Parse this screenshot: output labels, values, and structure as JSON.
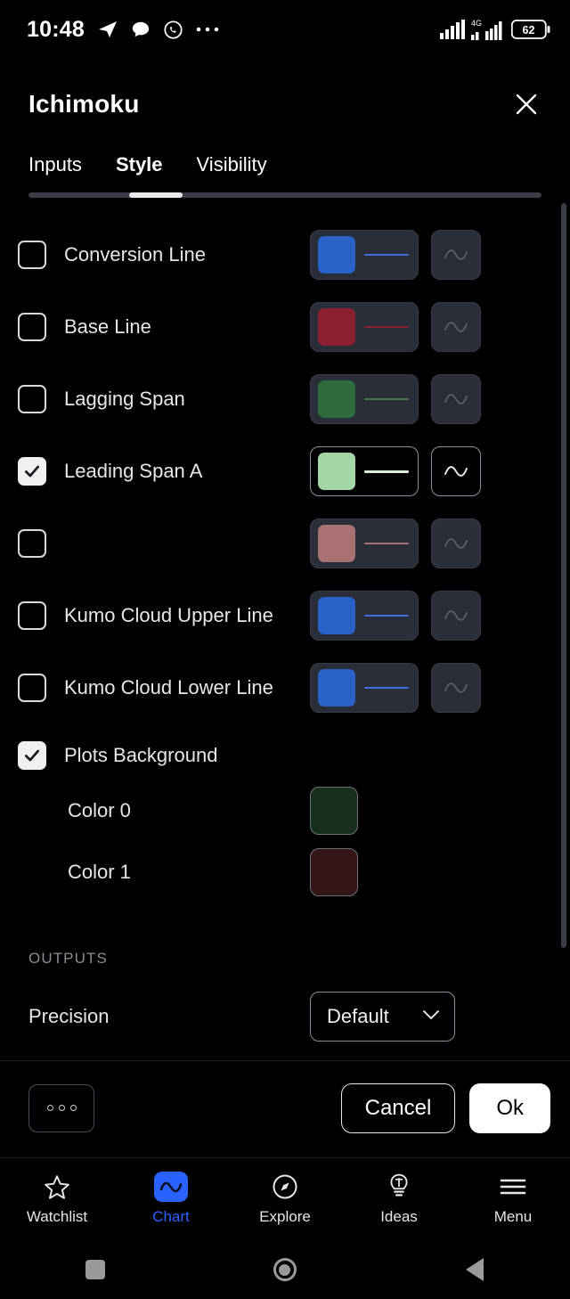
{
  "status_bar": {
    "time": "10:48",
    "network": "4G",
    "battery": "62",
    "icons": [
      "telegram-icon",
      "chat-bubble-icon",
      "whatsapp-icon",
      "overflow-dots-icon"
    ]
  },
  "dialog": {
    "title": "Ichimoku",
    "close_label": "×"
  },
  "tabs": {
    "items": [
      {
        "label": "Inputs",
        "active": false
      },
      {
        "label": "Style",
        "active": true
      },
      {
        "label": "Visibility",
        "active": false
      }
    ]
  },
  "style_rows": [
    {
      "label": "Conversion Line",
      "checked": false,
      "color": "#2962c8",
      "line_color": "#3f6fd8",
      "has_swatch": true
    },
    {
      "label": "Base Line",
      "checked": false,
      "color": "#8b2130",
      "line_color": "#8b2130",
      "has_swatch": true
    },
    {
      "label": "Lagging Span",
      "checked": false,
      "color": "#2e6b3d",
      "line_color": "#3d7a4c",
      "has_swatch": true
    },
    {
      "label": "Leading Span A",
      "checked": true,
      "color": "#a5d6a7",
      "line_color": "#d8f0d9",
      "has_swatch": true
    },
    {
      "label": "",
      "checked": false,
      "color": "#a97272",
      "line_color": "#a97272",
      "has_swatch": true
    },
    {
      "label": "Kumo Cloud Upper Line",
      "checked": false,
      "color": "#2962c8",
      "line_color": "#3f6fd8",
      "has_swatch": true
    },
    {
      "label": "Kumo Cloud Lower Line",
      "checked": false,
      "color": "#2962c8",
      "line_color": "#3f6fd8",
      "has_swatch": true
    }
  ],
  "plots_background": {
    "label": "Plots Background",
    "checked": true,
    "colors": [
      {
        "label": "Color 0",
        "color": "#16301c"
      },
      {
        "label": "Color 1",
        "color": "#341516"
      }
    ]
  },
  "outputs": {
    "section_label": "OUTPUTS",
    "precision_label": "Precision",
    "precision_value": "Default"
  },
  "action_bar": {
    "more_label": "000",
    "cancel_label": "Cancel",
    "ok_label": "Ok"
  },
  "bottom_nav": {
    "items": [
      {
        "label": "Watchlist",
        "icon": "star-icon",
        "active": false
      },
      {
        "label": "Chart",
        "icon": "chart-wave-icon",
        "active": true
      },
      {
        "label": "Explore",
        "icon": "compass-icon",
        "active": false
      },
      {
        "label": "Ideas",
        "icon": "lightbulb-icon",
        "active": false
      },
      {
        "label": "Menu",
        "icon": "hamburger-icon",
        "active": false
      }
    ],
    "accent_color": "#2962ff"
  },
  "system_nav": {
    "items": [
      "recents-square-icon",
      "home-circle-icon",
      "back-triangle-icon"
    ]
  }
}
